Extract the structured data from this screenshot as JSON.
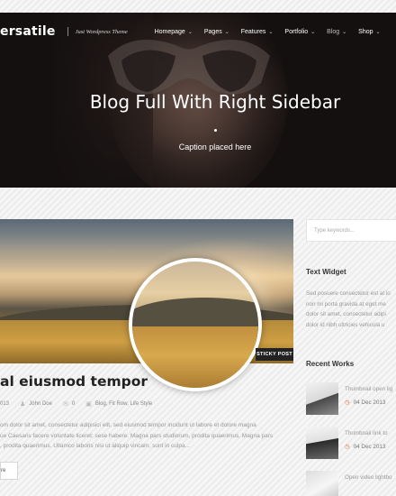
{
  "header": {
    "logo": "ersatile",
    "tagline": "Just Wordpress Theme",
    "nav": [
      {
        "label": "Homepage",
        "active": false
      },
      {
        "label": "Pages",
        "active": false
      },
      {
        "label": "Features",
        "active": false
      },
      {
        "label": "Portfolio",
        "active": false
      },
      {
        "label": "Blog",
        "active": true
      },
      {
        "label": "Shop",
        "active": false
      }
    ]
  },
  "hero": {
    "title": "Blog Full With Right Sidebar",
    "caption": "Caption placed here"
  },
  "post": {
    "badge": "STICKY POST",
    "title": "al eiusmod tempor",
    "meta": {
      "date": "013",
      "author": "John Doe",
      "comments": "0",
      "categories": "Blog, Fit Row, Life Style"
    },
    "excerpt": [
      "om dolor sit amet, consectetur adipisici elit, sed eiusmod tempor incidunt ut labore et dolore magna",
      "ue Caesaris facere voluntate liceret: sese habere. Magna pars studiorum, prodita quaerimus. Magna pars",
      ", prodita quaerimus. Ullamco laboris nisi ut aliquip vincam, sunt in culpa..."
    ],
    "more_label": "re"
  },
  "sidebar": {
    "search_placeholder": "Type keywords...",
    "text_widget": {
      "title": "Text Widget",
      "lines": [
        "Sed posuere consectetur est at lo",
        "non mi porta gravida at eget me",
        "dolor sit amet, consectetur adipi",
        "dolor id nibh ultricies vehicula u"
      ]
    },
    "recent_works": {
      "title": "Recent Works",
      "items": [
        {
          "name": "Thumbnail open lig",
          "date": "04 Dec 2013"
        },
        {
          "name": "Thumbnail link to",
          "date": "04 Dec 2013"
        },
        {
          "name": "Open video lightbo",
          "date": ""
        }
      ]
    }
  },
  "colors": {
    "accent": "#e36b2e",
    "sticky_badge_bg": "#222222"
  }
}
